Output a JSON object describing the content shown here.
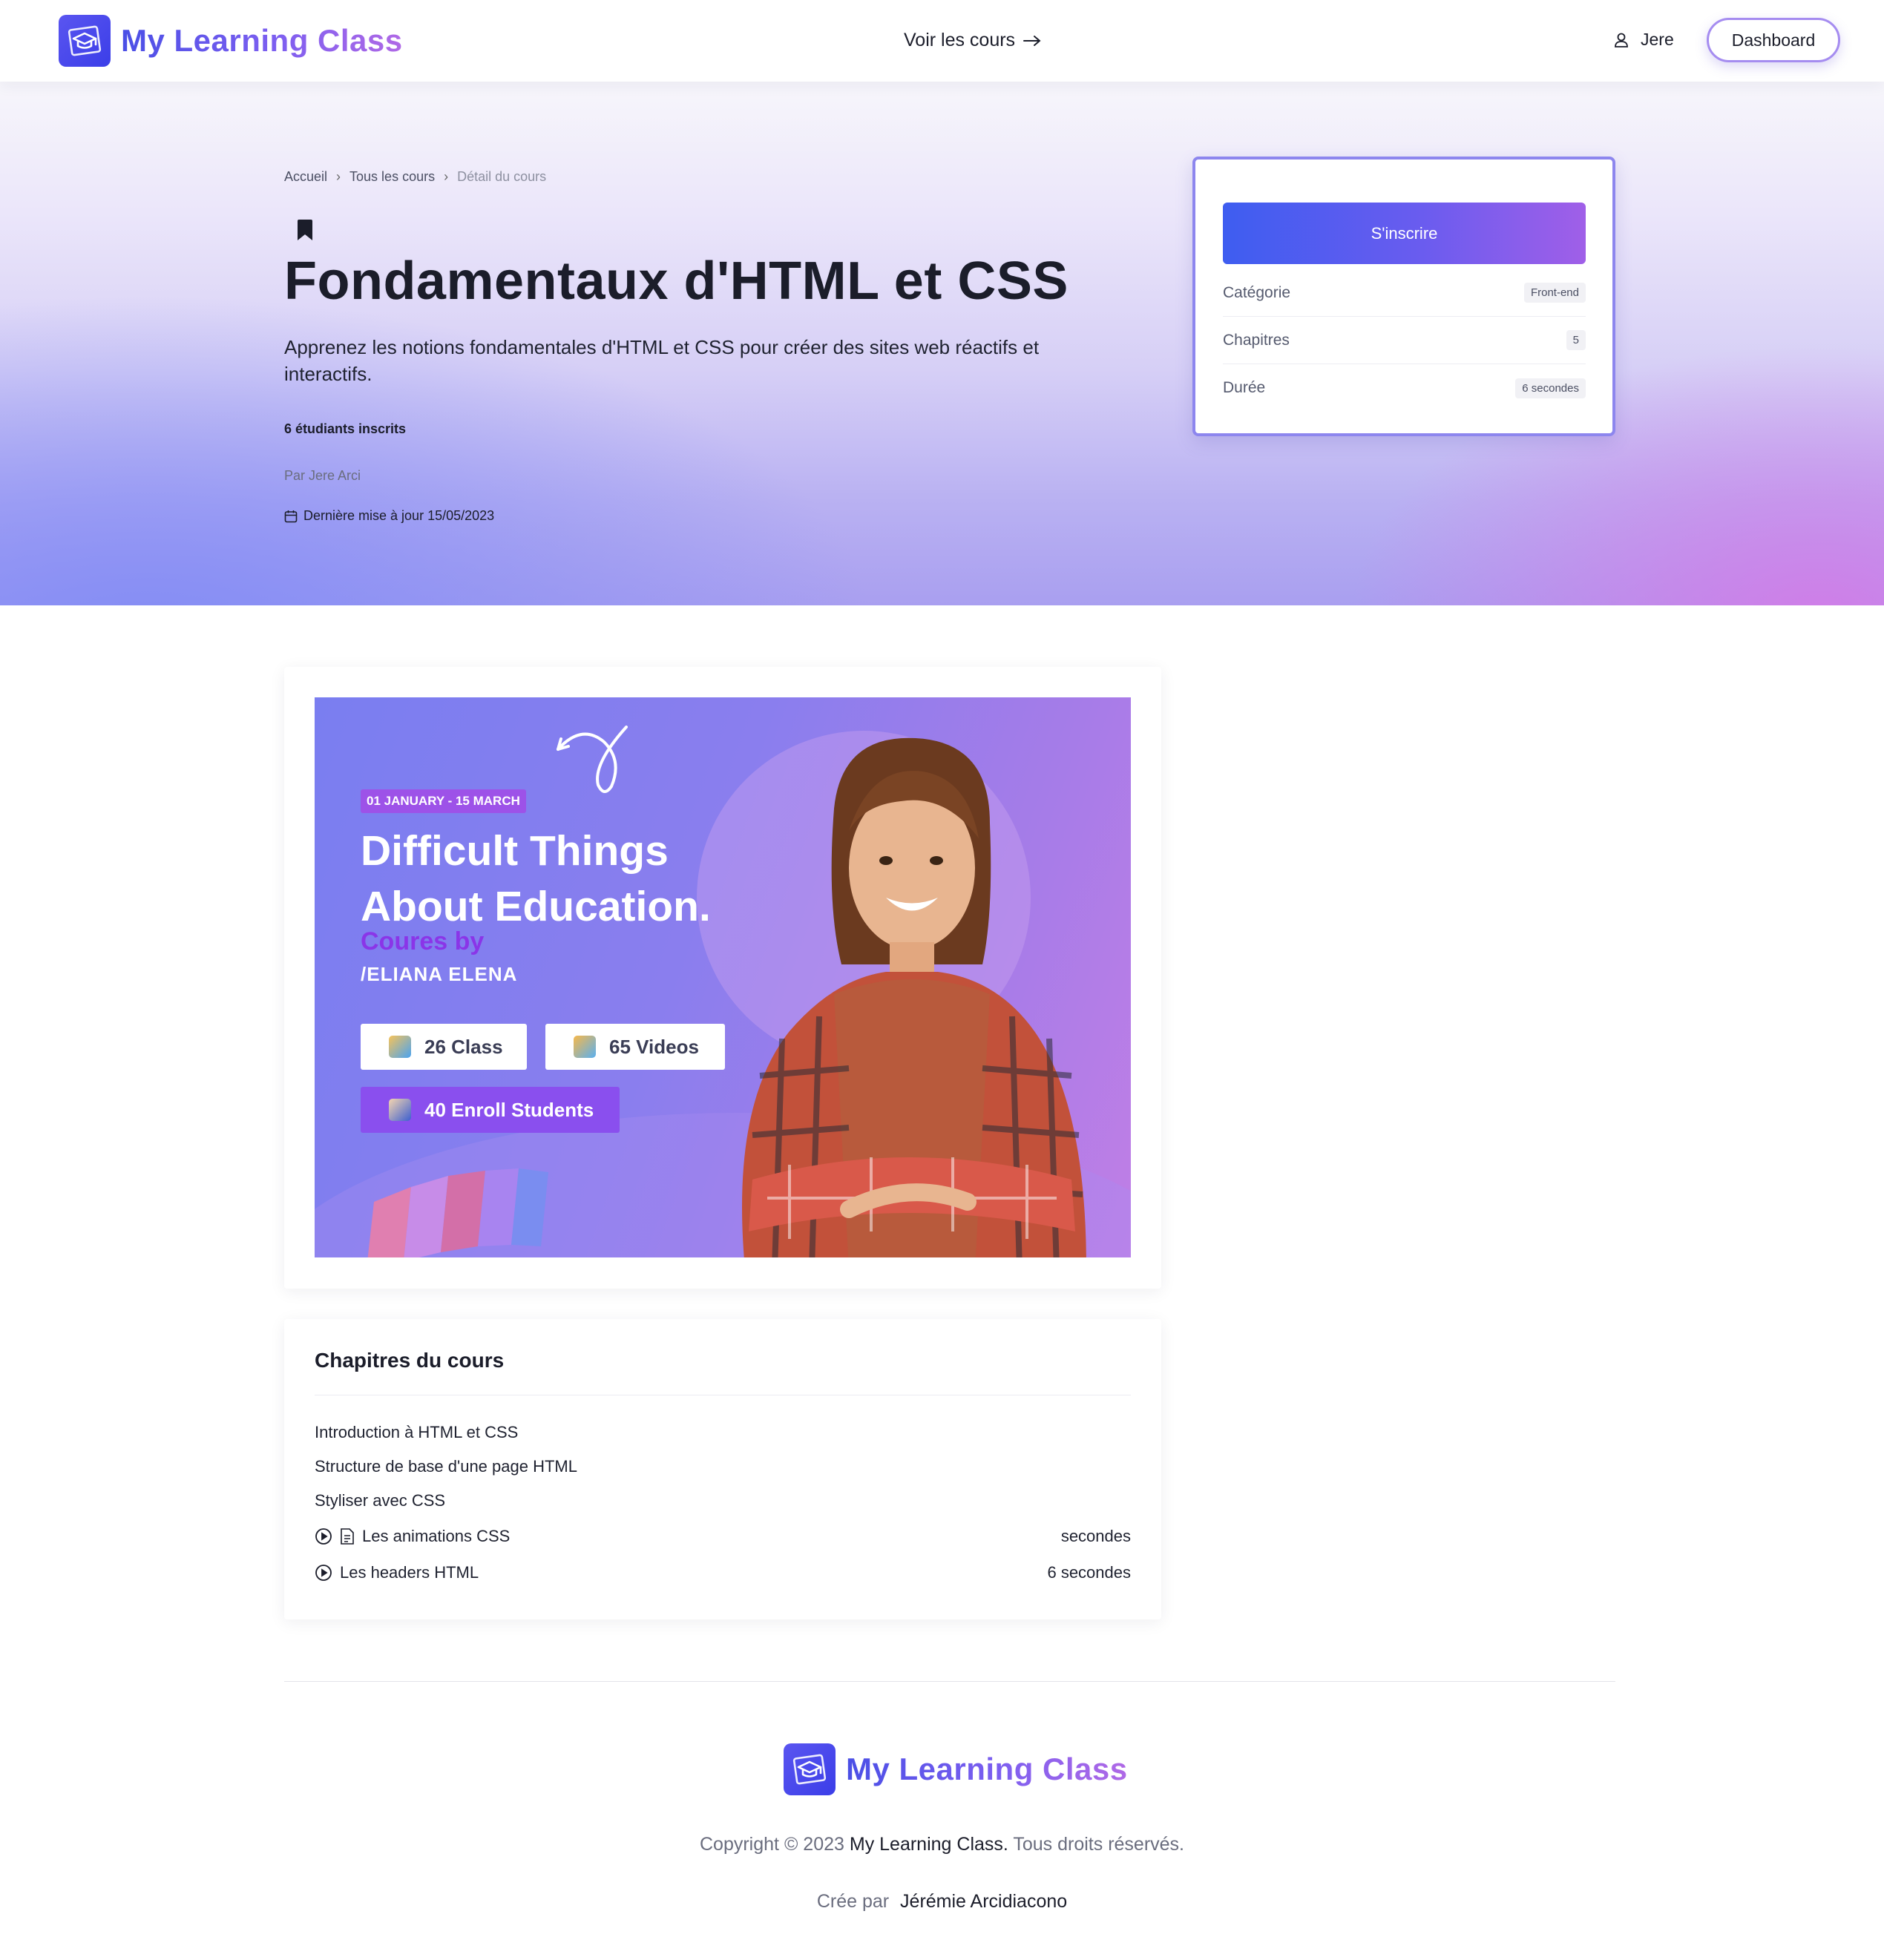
{
  "navbar": {
    "brand_name": "My Learning Class",
    "courses_link": "Voir les cours",
    "user_name": "Jere",
    "dashboard_button": "Dashboard"
  },
  "hero": {
    "breadcrumb": [
      "Accueil",
      "Tous les cours",
      "Détail du cours"
    ],
    "title": "Fondamentaux d'HTML et CSS",
    "description": "Apprenez les notions fondamentales d'HTML et CSS pour créer des sites web réactifs et interactifs.",
    "students": "6 étudiants inscrits",
    "author": "Par Jere Arci",
    "last_updated": "Dernière mise à jour 15/05/2023"
  },
  "sidebar": {
    "enroll_button": "S'inscrire",
    "rows": [
      {
        "label": "Catégorie",
        "value": "Front-end"
      },
      {
        "label": "Chapitres",
        "value": "5"
      },
      {
        "label": "Durée",
        "value": "6 secondes"
      }
    ]
  },
  "banner": {
    "date_tag": "01 JANUARY - 15 MARCH",
    "title_line1": "Difficult Things",
    "title_line2": "About Education.",
    "by": "Coures by",
    "name": "/ELIANA ELENA",
    "pill_class": "26 Class",
    "pill_videos": "65 Videos",
    "pill_students": "40 Enroll Students"
  },
  "chapters": {
    "title": "Chapitres du cours",
    "items": [
      {
        "label": "Introduction à HTML et CSS",
        "duration": ""
      },
      {
        "label": "Structure de base d'une page HTML",
        "duration": ""
      },
      {
        "label": "Styliser avec CSS",
        "duration": ""
      },
      {
        "label": "Les animations CSS",
        "duration": "secondes"
      },
      {
        "label": "Les headers HTML",
        "duration": "6 secondes"
      }
    ]
  },
  "footer": {
    "brand_name": "My Learning Class",
    "copyright_prefix": "Copyright © 2023",
    "copyright_brand": "My Learning Class.",
    "copyright_suffix": "Tous droits réservés.",
    "credit_prefix": "Crée par",
    "credit_name": "Jérémie Arcidiacono"
  },
  "colors": {
    "brand_blue": "#3b3ee8",
    "brand_purple": "#b069e6",
    "card_border": "#8d86ee"
  }
}
